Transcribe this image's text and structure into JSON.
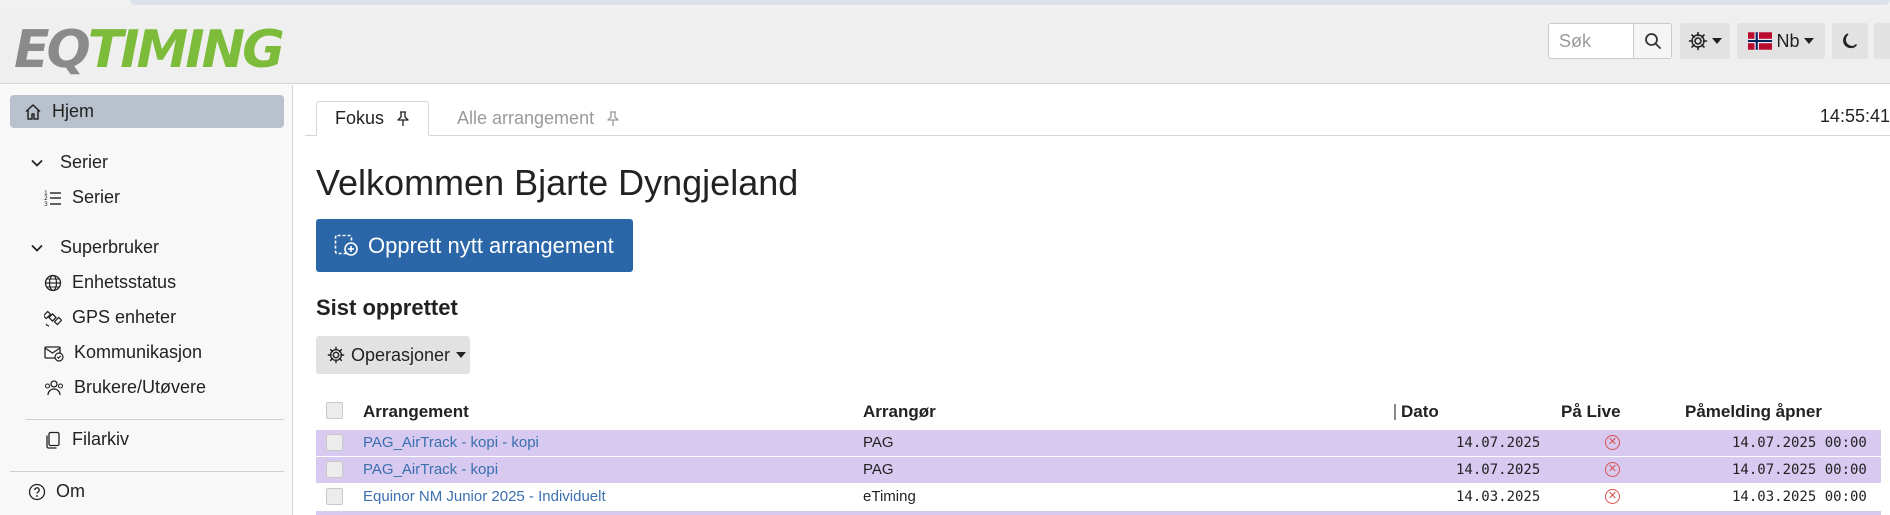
{
  "logo": {
    "part1": "EQ",
    "part2": "TIMING"
  },
  "header": {
    "search_placeholder": "Søk",
    "language_label": "Nb"
  },
  "sidebar": {
    "home": "Hjem",
    "group_series": "Serier",
    "series_item": "Serier",
    "group_superuser": "Superbruker",
    "items": [
      "Enhetsstatus",
      "GPS enheter",
      "Kommunikasjon",
      "Brukere/Utøvere"
    ],
    "archive": "Filarkiv",
    "about": "Om"
  },
  "tabs": {
    "focus": "Fokus",
    "all_events": "Alle arrangement"
  },
  "clock": "14:55:41",
  "main": {
    "welcome": "Velkommen Bjarte Dyngjeland",
    "create_button": "Opprett nytt arrangement",
    "recent_heading": "Sist opprettet",
    "operations_button": "Operasjoner"
  },
  "table": {
    "headers": [
      "Arrangement",
      "Arrangør",
      "Dato",
      "På Live",
      "Påmelding åpner"
    ],
    "rows": [
      {
        "event": "PAG_AirTrack - kopi - kopi",
        "organizer": "PAG",
        "date": "14.07.2025",
        "registration_opens": "14.07.2025 00:00",
        "highlighted": true
      },
      {
        "event": "PAG_AirTrack - kopi",
        "organizer": "PAG",
        "date": "14.07.2025",
        "registration_opens": "14.07.2025 00:00",
        "highlighted": true
      },
      {
        "event": "Equinor NM Junior 2025 - Individuelt",
        "organizer": "eTiming",
        "date": "14.03.2025",
        "registration_opens": "14.03.2025 00:00",
        "highlighted": false
      }
    ]
  },
  "colors": {
    "primary": "#2a66a8",
    "highlight_row": "#d7c9ef",
    "logo_green": "#7dbb3a",
    "logo_gray": "#8a8a8a",
    "live_off": "#d9534f"
  }
}
